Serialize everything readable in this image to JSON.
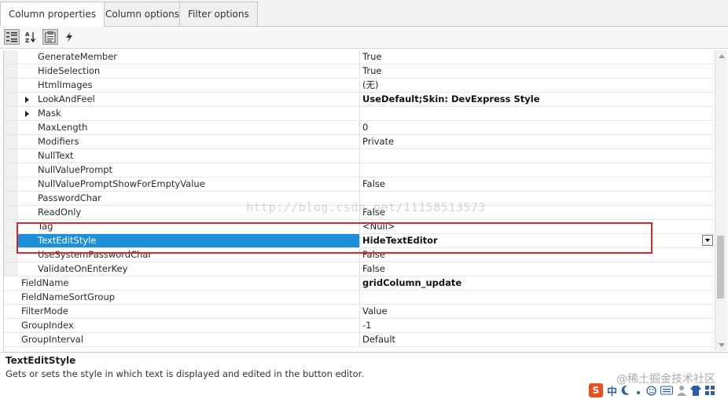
{
  "tabs": [
    {
      "label": "Column properties",
      "active": true
    },
    {
      "label": "Column options",
      "active": false
    },
    {
      "label": "Filter options",
      "active": false
    }
  ],
  "toolbar": {
    "buttons": [
      {
        "icon": "categorized-icon",
        "active": true
      },
      {
        "icon": "sort-alphabetical-icon",
        "active": false
      },
      {
        "icon": "property-pages-icon",
        "active": true
      },
      {
        "icon": "events-lightning-icon",
        "active": false
      }
    ]
  },
  "properties": [
    {
      "name": "GenerateMember",
      "value": "True",
      "indent": true,
      "bold": false,
      "expandable": false
    },
    {
      "name": "HideSelection",
      "value": "True",
      "indent": true,
      "bold": false,
      "expandable": false
    },
    {
      "name": "HtmlImages",
      "value": "(无)",
      "indent": true,
      "bold": false,
      "expandable": false
    },
    {
      "name": "LookAndFeel",
      "value": "UseDefault;Skin: DevExpress Style",
      "indent": true,
      "bold": true,
      "expandable": true
    },
    {
      "name": "Mask",
      "value": "",
      "indent": true,
      "bold": false,
      "expandable": true
    },
    {
      "name": "MaxLength",
      "value": "0",
      "indent": true,
      "bold": false,
      "expandable": false
    },
    {
      "name": "Modifiers",
      "value": "Private",
      "indent": true,
      "bold": false,
      "expandable": false
    },
    {
      "name": "NullText",
      "value": "",
      "indent": true,
      "bold": false,
      "expandable": false
    },
    {
      "name": "NullValuePrompt",
      "value": "",
      "indent": true,
      "bold": false,
      "expandable": false
    },
    {
      "name": "NullValuePromptShowForEmptyValue",
      "value": "False",
      "indent": true,
      "bold": false,
      "expandable": false
    },
    {
      "name": "PasswordChar",
      "value": "",
      "indent": true,
      "bold": false,
      "expandable": false
    },
    {
      "name": "ReadOnly",
      "value": "False",
      "indent": true,
      "bold": false,
      "expandable": false
    },
    {
      "name": "Tag",
      "value": "<Null>",
      "indent": true,
      "bold": false,
      "expandable": false
    },
    {
      "name": "TextEditStyle",
      "value": "HideTextEditor",
      "indent": true,
      "bold": true,
      "expandable": false,
      "selected": true
    },
    {
      "name": "UseSystemPasswordChar",
      "value": "False",
      "indent": true,
      "bold": false,
      "expandable": false
    },
    {
      "name": "ValidateOnEnterKey",
      "value": "False",
      "indent": true,
      "bold": false,
      "expandable": false
    },
    {
      "name": "FieldName",
      "value": "gridColumn_update",
      "indent": false,
      "bold": true,
      "expandable": false
    },
    {
      "name": "FieldNameSortGroup",
      "value": "",
      "indent": false,
      "bold": false,
      "expandable": false
    },
    {
      "name": "FilterMode",
      "value": "Value",
      "indent": false,
      "bold": false,
      "expandable": false
    },
    {
      "name": "GroupIndex",
      "value": "-1",
      "indent": false,
      "bold": false,
      "expandable": false
    },
    {
      "name": "GroupInterval",
      "value": "Default",
      "indent": false,
      "bold": false,
      "expandable": false
    }
  ],
  "description": {
    "title": "TextEditStyle",
    "text": "Gets or sets the style in which text is displayed and edited in the button editor."
  },
  "watermark": "http://blog.csdn.net/11158513573",
  "credit": "@稀土掘金技术社区",
  "ime": {
    "label": "S",
    "mode": "中"
  },
  "colors": {
    "selection": "#1e8fd9",
    "highlight_border": "#d9272e"
  }
}
